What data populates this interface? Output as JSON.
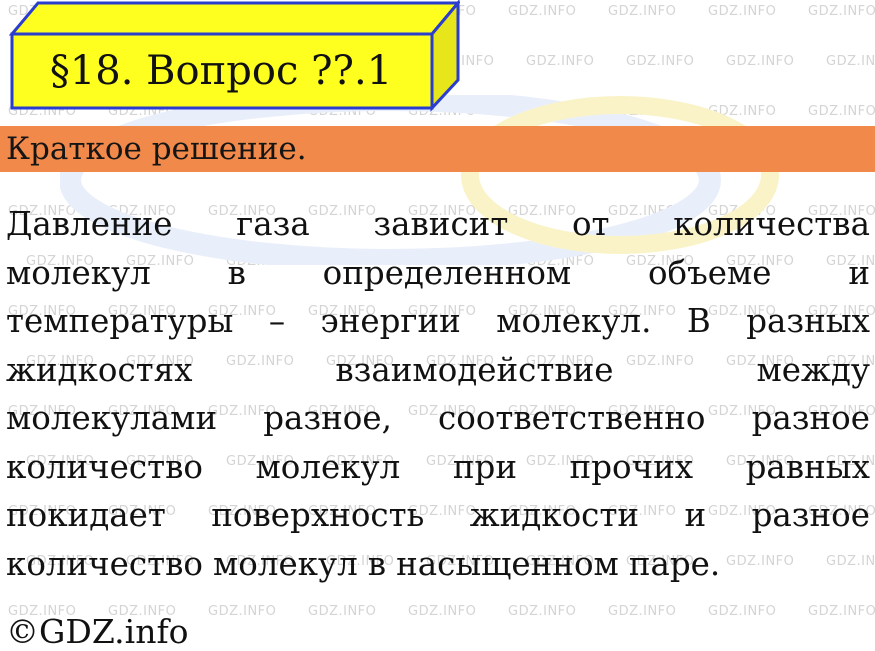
{
  "title": "§18. Вопрос ??.1",
  "subheading": "Краткое решение.",
  "body_lines": [
    [
      "Давление",
      "газа",
      "зависит",
      "от",
      "количества"
    ],
    [
      "молекул",
      "в",
      "определенном",
      "объеме",
      "и"
    ],
    [
      "температуры",
      "–",
      "энергии",
      "молекул.",
      "В",
      "разных"
    ],
    [
      "жидкостях",
      "взаимодействие",
      "между"
    ],
    [
      "молекулами",
      "разное,",
      "соответственно",
      "разное"
    ],
    [
      "количество",
      "молекул",
      "при",
      "прочих",
      "равных"
    ],
    [
      "покидает",
      "поверхность",
      "жидкости",
      "и",
      "разное"
    ],
    [
      "количество",
      "молекул",
      "в",
      "насыщенном",
      "паре."
    ]
  ],
  "copyright": "©GDZ.info",
  "watermark_text": "GDZ.INFO",
  "colors": {
    "title_fill": "#ffff1f",
    "title_side": "#e6e61a",
    "title_border": "#2a3dcc",
    "band": "#f0894a",
    "text": "#111111"
  }
}
